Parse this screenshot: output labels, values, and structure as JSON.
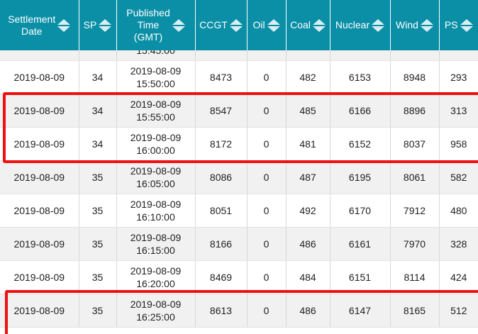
{
  "table": {
    "columns": [
      {
        "key": "date",
        "label": "Settlement\nDate"
      },
      {
        "key": "sp",
        "label": "SP"
      },
      {
        "key": "time",
        "label": "Published\nTime\n(GMT)"
      },
      {
        "key": "ccgt",
        "label": "CCGT"
      },
      {
        "key": "oil",
        "label": "Oil"
      },
      {
        "key": "coal",
        "label": "Coal"
      },
      {
        "key": "nuclear",
        "label": "Nuclear"
      },
      {
        "key": "wind",
        "label": "Wind"
      },
      {
        "key": "ps",
        "label": "PS"
      }
    ],
    "partial_row_time": "15:45:00",
    "rows": [
      [
        "2019-08-09",
        "34",
        "2019-08-09\n15:50:00",
        "8473",
        "0",
        "482",
        "6153",
        "8948",
        "293"
      ],
      [
        "2019-08-09",
        "34",
        "2019-08-09\n15:55:00",
        "8547",
        "0",
        "485",
        "6166",
        "8896",
        "313"
      ],
      [
        "2019-08-09",
        "34",
        "2019-08-09\n16:00:00",
        "8172",
        "0",
        "481",
        "6152",
        "8037",
        "958"
      ],
      [
        "2019-08-09",
        "35",
        "2019-08-09\n16:05:00",
        "8086",
        "0",
        "487",
        "6195",
        "8061",
        "582"
      ],
      [
        "2019-08-09",
        "35",
        "2019-08-09\n16:10:00",
        "8051",
        "0",
        "492",
        "6170",
        "7912",
        "480"
      ],
      [
        "2019-08-09",
        "35",
        "2019-08-09\n16:15:00",
        "8166",
        "0",
        "486",
        "6161",
        "7970",
        "328"
      ],
      [
        "2019-08-09",
        "35",
        "2019-08-09\n16:20:00",
        "8469",
        "0",
        "484",
        "6151",
        "8114",
        "424"
      ],
      [
        "2019-08-09",
        "35",
        "2019-08-09\n16:25:00",
        "8613",
        "0",
        "486",
        "6147",
        "8165",
        "512"
      ]
    ]
  },
  "colors": {
    "header_bg": "#0b8fa6",
    "highlight": "#ee1111",
    "row_shade": "#f1f1f1"
  }
}
